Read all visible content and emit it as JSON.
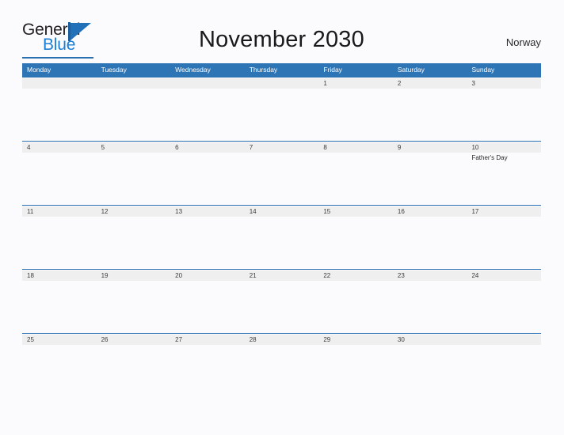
{
  "brand": {
    "name_part1": "General",
    "name_part2": "Blue",
    "logo_icon": "triangle-flag-icon",
    "accent_color": "#1b7fd4",
    "mark_color": "#2170b8"
  },
  "header": {
    "title": "November 2030",
    "country": "Norway"
  },
  "theme": {
    "header_blue": "#2e75b6",
    "rule_blue": "#2a6fb0",
    "band_gray": "#efefef",
    "page_background": "#fbfbfd",
    "text_color": "#3a3a3a"
  },
  "calendar": {
    "month": "November",
    "year": "2030",
    "weekday_headers": [
      "Monday",
      "Tuesday",
      "Wednesday",
      "Thursday",
      "Friday",
      "Saturday",
      "Sunday"
    ],
    "weeks": [
      [
        {
          "day": "",
          "event": "",
          "shaded": true
        },
        {
          "day": "",
          "event": "",
          "shaded": true
        },
        {
          "day": "",
          "event": "",
          "shaded": true
        },
        {
          "day": "",
          "event": "",
          "shaded": true
        },
        {
          "day": "1",
          "event": "",
          "shaded": true
        },
        {
          "day": "2",
          "event": "",
          "shaded": true
        },
        {
          "day": "3",
          "event": "",
          "shaded": true
        }
      ],
      [
        {
          "day": "4",
          "event": "",
          "shaded": true
        },
        {
          "day": "5",
          "event": "",
          "shaded": true
        },
        {
          "day": "6",
          "event": "",
          "shaded": true
        },
        {
          "day": "7",
          "event": "",
          "shaded": true
        },
        {
          "day": "8",
          "event": "",
          "shaded": true
        },
        {
          "day": "9",
          "event": "",
          "shaded": true
        },
        {
          "day": "10",
          "event": "Father's Day",
          "shaded": true
        }
      ],
      [
        {
          "day": "11",
          "event": "",
          "shaded": true
        },
        {
          "day": "12",
          "event": "",
          "shaded": true
        },
        {
          "day": "13",
          "event": "",
          "shaded": true
        },
        {
          "day": "14",
          "event": "",
          "shaded": true
        },
        {
          "day": "15",
          "event": "",
          "shaded": true
        },
        {
          "day": "16",
          "event": "",
          "shaded": true
        },
        {
          "day": "17",
          "event": "",
          "shaded": true
        }
      ],
      [
        {
          "day": "18",
          "event": "",
          "shaded": true
        },
        {
          "day": "19",
          "event": "",
          "shaded": true
        },
        {
          "day": "20",
          "event": "",
          "shaded": true
        },
        {
          "day": "21",
          "event": "",
          "shaded": true
        },
        {
          "day": "22",
          "event": "",
          "shaded": true
        },
        {
          "day": "23",
          "event": "",
          "shaded": true
        },
        {
          "day": "24",
          "event": "",
          "shaded": true
        }
      ],
      [
        {
          "day": "25",
          "event": "",
          "shaded": true
        },
        {
          "day": "26",
          "event": "",
          "shaded": true
        },
        {
          "day": "27",
          "event": "",
          "shaded": true
        },
        {
          "day": "28",
          "event": "",
          "shaded": true
        },
        {
          "day": "29",
          "event": "",
          "shaded": true
        },
        {
          "day": "30",
          "event": "",
          "shaded": true
        },
        {
          "day": "",
          "event": "",
          "shaded": true
        }
      ]
    ]
  }
}
